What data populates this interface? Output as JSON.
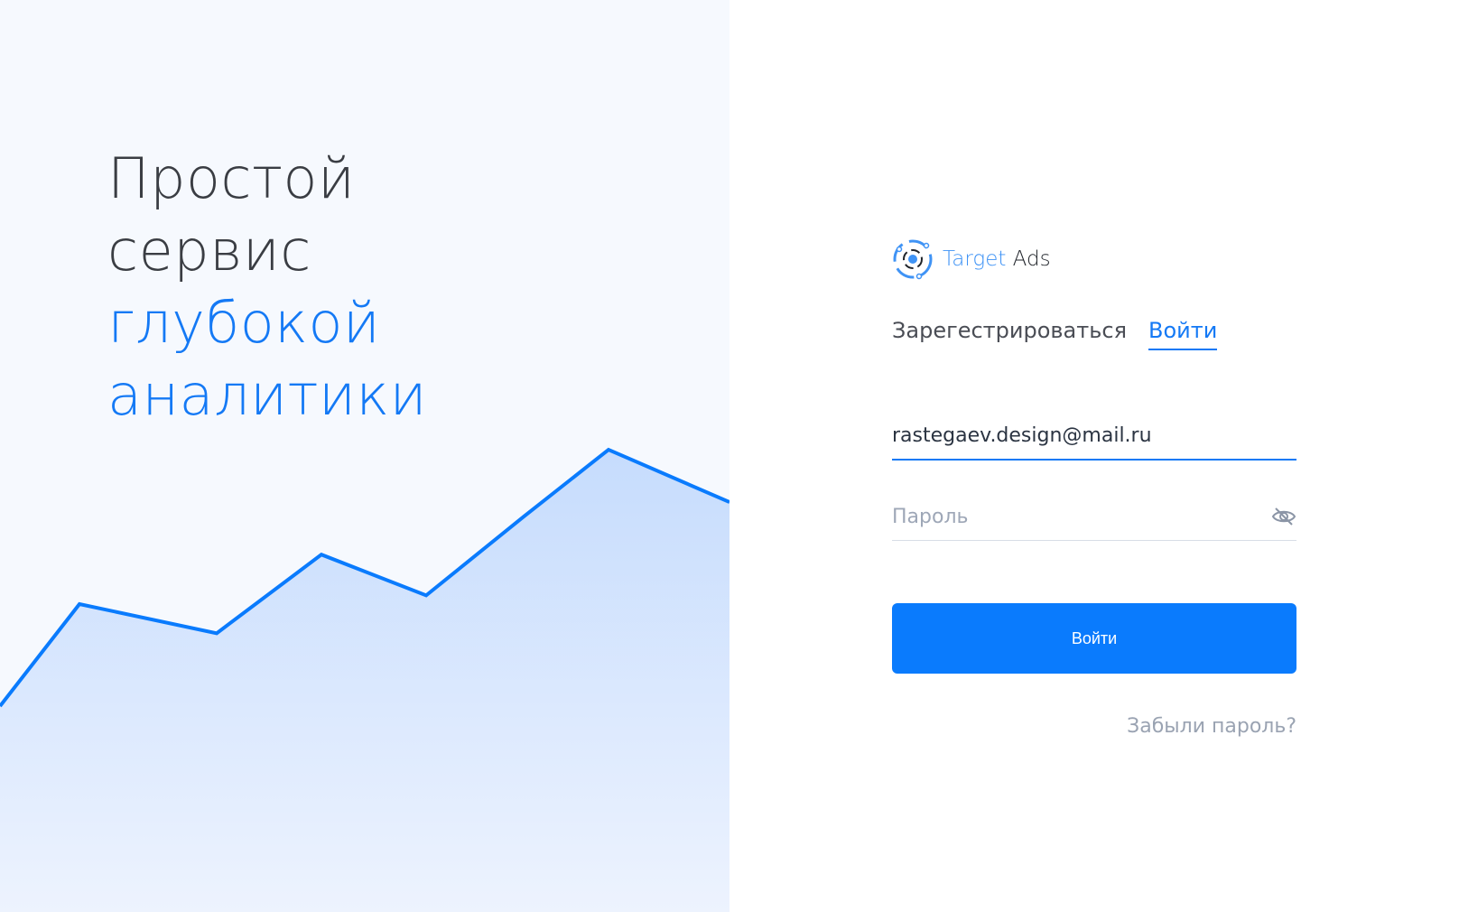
{
  "hero": {
    "line1": "Простой",
    "line2": "сервис",
    "line3": "глубокой",
    "line4": "аналитики"
  },
  "chart_data": {
    "type": "area",
    "values": [
      20,
      55,
      45,
      72,
      58,
      85,
      108,
      90
    ]
  },
  "brand": {
    "name_part1": "Target",
    "name_part2": "Ads"
  },
  "tabs": {
    "register": "Зарегестрироваться",
    "login": "Войти"
  },
  "form": {
    "email_value": "rastegaev.design@mail.ru",
    "password_placeholder": "Пароль",
    "submit_label": "Войти",
    "forgot_label": "Забыли пароль?"
  },
  "colors": {
    "accent": "#0a7bfd",
    "chart_fill_top": "#c6dcfd",
    "chart_fill_bottom": "#edf3fe"
  }
}
